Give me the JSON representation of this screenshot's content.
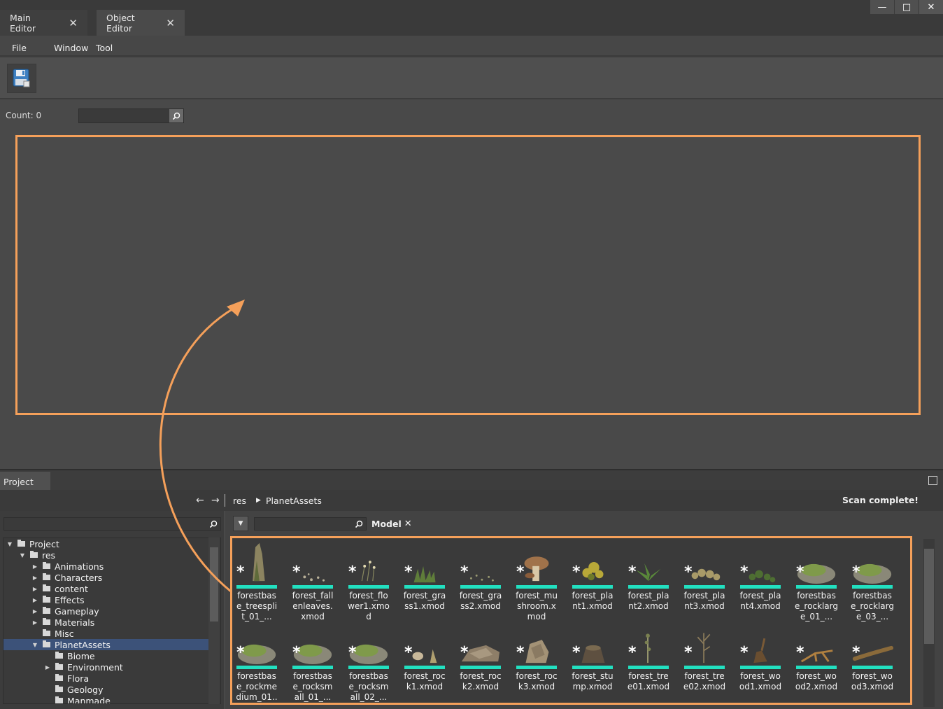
{
  "tabs": [
    {
      "label": "Main Editor"
    },
    {
      "label": "Object Editor"
    }
  ],
  "window_controls": {
    "minimize": "—",
    "maximize": "□",
    "close": "✕"
  },
  "menu": [
    "File",
    "Window",
    "Tool"
  ],
  "toolbar": {
    "save_icon": "floppy-disk-icon"
  },
  "object_editor": {
    "count_label": "Count: 0",
    "search_value": ""
  },
  "project": {
    "tab_label": "Project",
    "breadcrumb": [
      "res",
      "PlanetAssets"
    ],
    "status": "Scan complete!",
    "tree_search_value": "",
    "asset_search_value": "",
    "filter_tag": "Model",
    "tree": [
      {
        "label": "Project",
        "depth": 0,
        "expanded": true
      },
      {
        "label": "res",
        "depth": 1,
        "expanded": true
      },
      {
        "label": "Animations",
        "depth": 2,
        "expanded": false
      },
      {
        "label": "Characters",
        "depth": 2,
        "expanded": false
      },
      {
        "label": "content",
        "depth": 2,
        "expanded": false
      },
      {
        "label": "Effects",
        "depth": 2,
        "expanded": false
      },
      {
        "label": "Gameplay",
        "depth": 2,
        "expanded": false
      },
      {
        "label": "Materials",
        "depth": 2,
        "expanded": false
      },
      {
        "label": "Misc",
        "depth": 2,
        "expanded": null
      },
      {
        "label": "PlanetAssets",
        "depth": 2,
        "expanded": true,
        "selected": true
      },
      {
        "label": "Biome",
        "depth": 3,
        "expanded": null
      },
      {
        "label": "Environment",
        "depth": 3,
        "expanded": false
      },
      {
        "label": "Flora",
        "depth": 3,
        "expanded": null
      },
      {
        "label": "Geology",
        "depth": 3,
        "expanded": null
      },
      {
        "label": "Manmade",
        "depth": 3,
        "expanded": null
      }
    ],
    "assets": [
      {
        "label": "forestbase_treesplit_01_...",
        "kind": "tree-split"
      },
      {
        "label": "forest_fallenleaves.xmod",
        "kind": "leaves"
      },
      {
        "label": "forest_flower1.xmod",
        "kind": "flower"
      },
      {
        "label": "forest_grass1.xmod",
        "kind": "grass"
      },
      {
        "label": "forest_grass2.xmod",
        "kind": "grass-sparse"
      },
      {
        "label": "forest_mushroom.xmod",
        "kind": "mushroom"
      },
      {
        "label": "forest_plant1.xmod",
        "kind": "plant-yellow"
      },
      {
        "label": "forest_plant2.xmod",
        "kind": "fern"
      },
      {
        "label": "forest_plant3.xmod",
        "kind": "plant-dry"
      },
      {
        "label": "forest_plant4.xmod",
        "kind": "plant-green"
      },
      {
        "label": "forestbase_rocklarge_01_...",
        "kind": "rock-moss"
      },
      {
        "label": "forestbase_rocklarge_03_...",
        "kind": "rock-moss"
      },
      {
        "label": "forestbase_rockmedium_01..",
        "kind": "rock-moss"
      },
      {
        "label": "forestbase_rocksmall_01_...",
        "kind": "rock-moss"
      },
      {
        "label": "forestbase_rocksmall_02_...",
        "kind": "rock-moss"
      },
      {
        "label": "forest_rock1.xmod",
        "kind": "rock-small"
      },
      {
        "label": "forest_rock2.xmod",
        "kind": "rock-brown"
      },
      {
        "label": "forest_rock3.xmod",
        "kind": "rock-tall"
      },
      {
        "label": "forest_stump.xmod",
        "kind": "stump"
      },
      {
        "label": "forest_tree01.xmod",
        "kind": "tree-thin"
      },
      {
        "label": "forest_tree02.xmod",
        "kind": "tree-bare"
      },
      {
        "label": "forest_wood1.xmod",
        "kind": "wood"
      },
      {
        "label": "forest_wood2.xmod",
        "kind": "wood-root"
      },
      {
        "label": "forest_wood3.xmod",
        "kind": "wood-log"
      }
    ]
  },
  "colors": {
    "accent_outline": "#f5a05a",
    "asset_bar": "#22e0c0",
    "selection": "#3c5279"
  }
}
